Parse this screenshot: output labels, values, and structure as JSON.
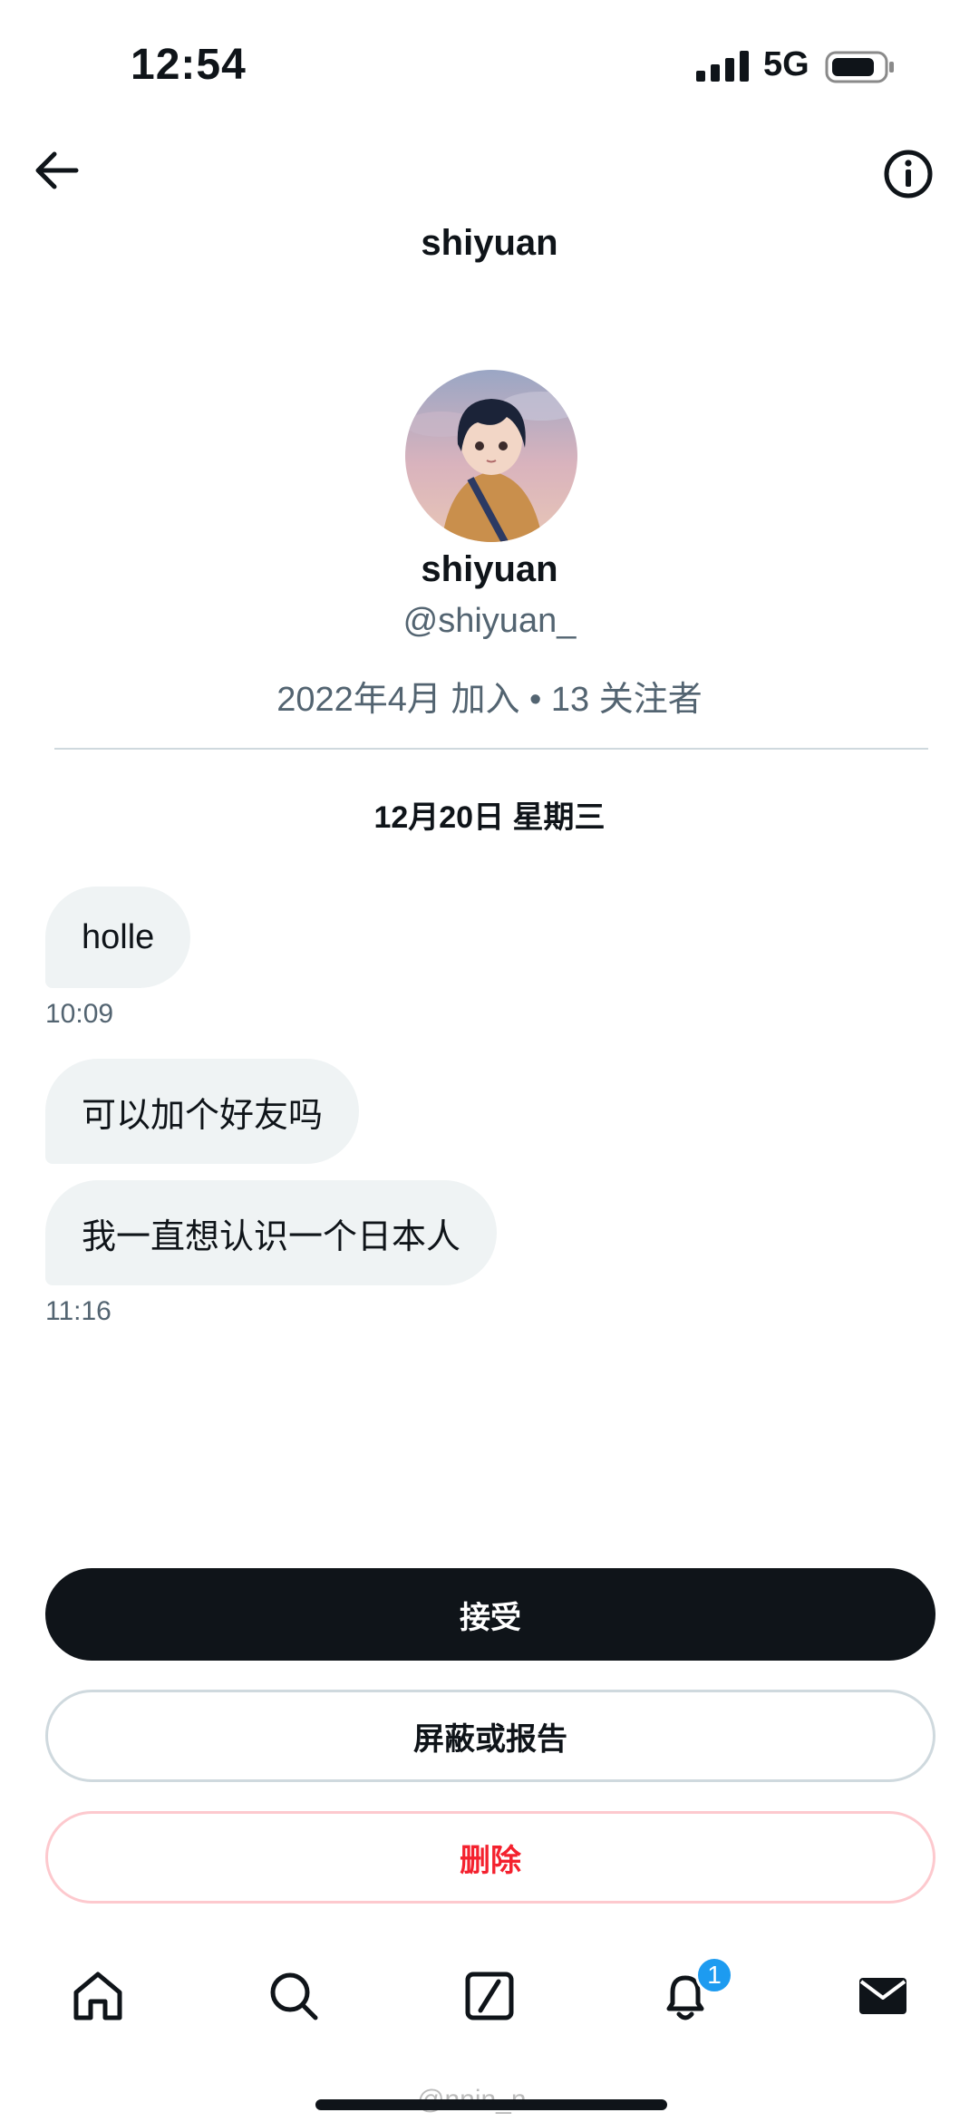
{
  "status_bar": {
    "time": "12:54",
    "network": "5G"
  },
  "header": {
    "title": "shiyuan"
  },
  "profile": {
    "name": "shiyuan",
    "handle": "@shiyuan_",
    "meta": "2022年4月 加入 • 13 关注者"
  },
  "conversation": {
    "date": "12月20日 星期三",
    "messages": [
      {
        "text": "holle"
      },
      {
        "text": "可以加个好友吗"
      },
      {
        "text": "我一直想认识一个日本人"
      }
    ],
    "timestamps": [
      "10:09",
      "11:16"
    ]
  },
  "actions": {
    "accept": "接受",
    "block_report": "屏蔽或报告",
    "delete": "删除"
  },
  "nav": {
    "items": [
      "home-icon",
      "search-icon",
      "communities-icon",
      "notifications-icon",
      "messages-icon"
    ],
    "notification_badge": "1"
  },
  "watermark": "@nnin_n",
  "colors": {
    "primary_text": "#0f1419",
    "secondary_text": "#536471",
    "bubble_bg": "#eff3f4",
    "danger": "#f4212e",
    "badge": "#1d9bf0"
  }
}
